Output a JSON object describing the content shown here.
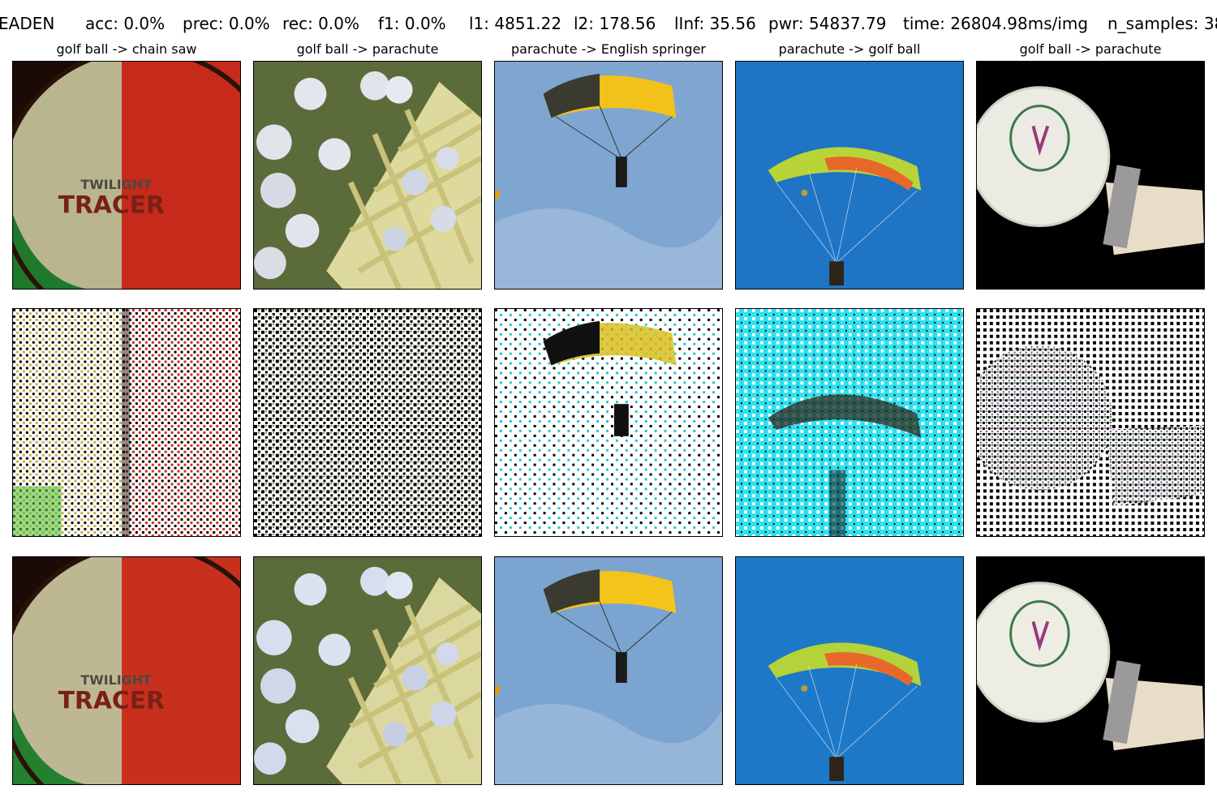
{
  "header": {
    "metrics": [
      "EADEN",
      "acc: 0.0%",
      "prec: 0.0%",
      "rec: 0.0%",
      "f1: 0.0%",
      "l1: 4851.22",
      "l2: 178.56",
      "lInf: 35.56",
      "pwr: 54837.79",
      "time: 26804.98ms/img",
      "n_samples: 38"
    ]
  },
  "columns": [
    {
      "caption": "golf ball -> chain saw",
      "image": "golf-ball-twilight-tracer"
    },
    {
      "caption": "golf ball -> parachute",
      "image": "golf-balls-in-basket"
    },
    {
      "caption": "parachute -> English springer",
      "image": "yellow-parachute-sky"
    },
    {
      "caption": "parachute -> golf ball",
      "image": "green-parachute-blue-sky"
    },
    {
      "caption": "golf ball -> parachute",
      "image": "golf-ball-with-cork"
    }
  ],
  "rows": [
    "original",
    "perturbation",
    "adversarial"
  ],
  "image_text": {
    "brand_small": "TWILIGHT",
    "brand_large": "TRACER"
  },
  "colors": {
    "background": "#ffffff",
    "text": "#000000",
    "panel_border": "#000000",
    "sky_blue": "#7fa6d0",
    "deep_blue": "#1f74c4",
    "parachute_yellow": "#f2c21b",
    "golf_ball_red": "#c52a1a"
  }
}
